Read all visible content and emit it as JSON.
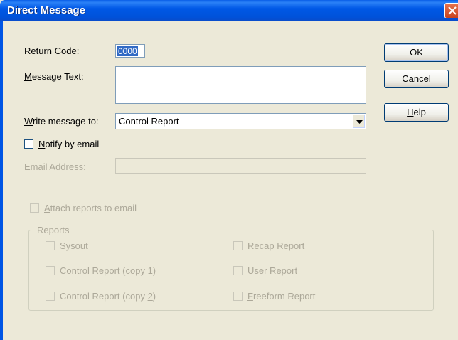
{
  "window": {
    "title": "Direct Message"
  },
  "form": {
    "return_code_label": [
      "R",
      "eturn Code:"
    ],
    "return_code_value": "0000",
    "message_text_label": [
      "M",
      "essage Text:"
    ],
    "message_text_value": "",
    "write_to_label": [
      "W",
      "rite message to:"
    ],
    "write_to_value": "Control Report",
    "notify_label": [
      "N",
      "otify by email"
    ],
    "notify_checked": false,
    "email_label": [
      "E",
      "mail Address:"
    ],
    "email_value": "",
    "attach_label": [
      "A",
      "ttach reports to email"
    ]
  },
  "reports": {
    "group_label": "Reports",
    "left": [
      {
        "pre": "",
        "u": "S",
        "post": "ysout"
      },
      {
        "pre": "Control Report (copy ",
        "u": "1",
        "post": ")"
      },
      {
        "pre": "Control Report (copy ",
        "u": "2",
        "post": ")"
      }
    ],
    "right": [
      {
        "pre": "Re",
        "u": "c",
        "post": "ap Report"
      },
      {
        "pre": "",
        "u": "U",
        "post": "ser Report"
      },
      {
        "pre": "",
        "u": "F",
        "post": "reeform Report"
      }
    ]
  },
  "buttons": {
    "ok": "OK",
    "cancel": "Cancel",
    "help": [
      "H",
      "elp"
    ]
  },
  "colors": {
    "titlebar": "#0054E3",
    "dialog_bg": "#ECE9D8",
    "disabled_text": "#ACA899",
    "selection": "#316AC5"
  }
}
